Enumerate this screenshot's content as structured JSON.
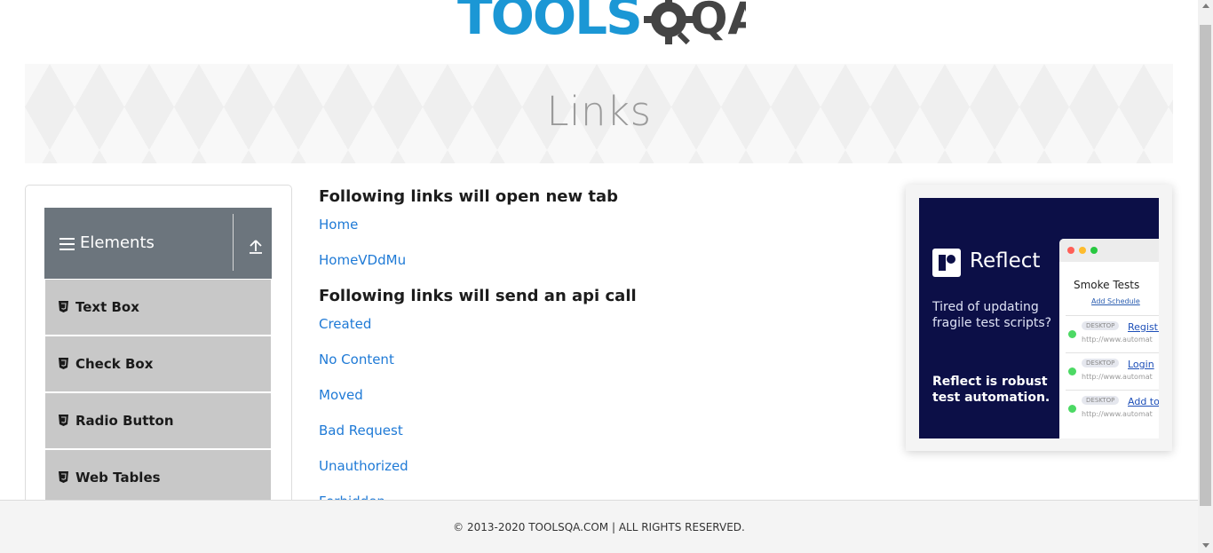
{
  "logo": {
    "text_primary": "TOOLS",
    "text_secondary": "QA",
    "alt": "ToolsQA logo"
  },
  "banner": {
    "title": "Links"
  },
  "sidebar": {
    "group": {
      "label": "Elements",
      "menu_icon": "hamburger-icon",
      "toggle_icon": "collapse-arrow-icon"
    },
    "items": [
      {
        "label": "Text Box",
        "icon": "html5-icon"
      },
      {
        "label": "Check Box",
        "icon": "html5-icon"
      },
      {
        "label": "Radio Button",
        "icon": "html5-icon"
      },
      {
        "label": "Web Tables",
        "icon": "html5-icon"
      }
    ]
  },
  "content": {
    "heading_new_tab": "Following links will open new tab",
    "new_tab_links": [
      "Home",
      "HomeVDdMu"
    ],
    "heading_api": "Following links will send an api call",
    "api_links": [
      "Created",
      "No Content",
      "Moved",
      "Bad Request",
      "Unauthorized",
      "Forbidden"
    ]
  },
  "ad": {
    "brand": "Reflect",
    "tagline": "Tired of updating fragile test scripts?",
    "cta": "Reflect is robust test automation.",
    "suite_title": "Smoke Tests",
    "add_schedule": "Add Schedule",
    "rows": [
      {
        "tag": "DESKTOP",
        "test": "Registr",
        "url": "http://www.automat"
      },
      {
        "tag": "DESKTOP",
        "test": "Login",
        "url": "http://www.automat"
      },
      {
        "tag": "DESKTOP",
        "test": "Add to",
        "url": "http://www.automat"
      }
    ]
  },
  "footer": {
    "text": "© 2013-2020 TOOLSQA.COM | ALL RIGHTS RESERVED."
  },
  "colors": {
    "link": "#1f7ad6",
    "sidebar_header": "#6c757d",
    "menu_item": "#c8c8c8",
    "logo_blue": "#1b97d5",
    "logo_dark": "#444444",
    "ad_bg": "#0c0f47"
  }
}
